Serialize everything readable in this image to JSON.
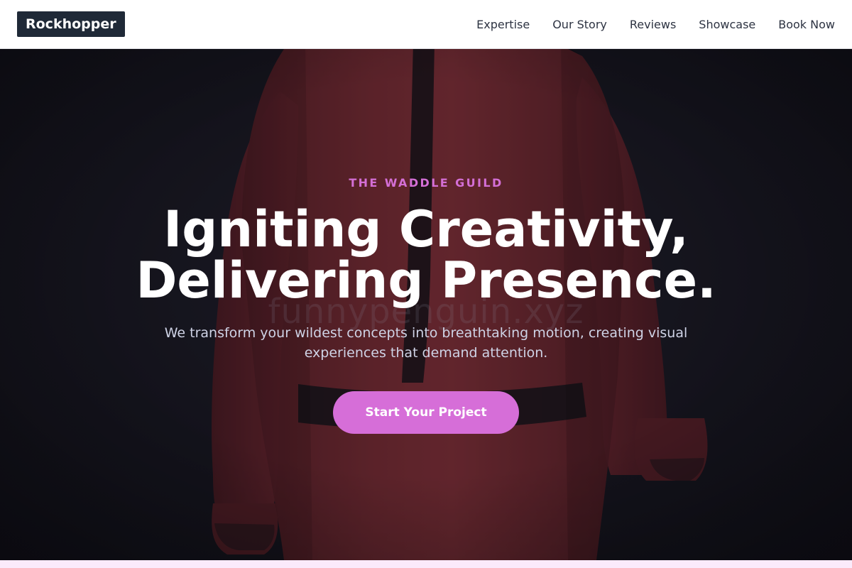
{
  "header": {
    "brand": "Rockhopper",
    "nav": [
      {
        "label": "Expertise"
      },
      {
        "label": "Our Story"
      },
      {
        "label": "Reviews"
      },
      {
        "label": "Showcase"
      },
      {
        "label": "Book Now"
      }
    ]
  },
  "hero": {
    "eyebrow": "THE WADDLE GUILD",
    "headline_line1": "Igniting Creativity,",
    "headline_line2": "Delivering Presence.",
    "subtext": "We transform your wildest concepts into breathtaking motion, creating visual experiences that demand attention.",
    "cta_label": "Start Your Project",
    "watermark": "funnypenguin.xyz",
    "image_subject": "red-suited-figure-back-view"
  },
  "colors": {
    "accent": "#d66ed8",
    "eyebrow": "#d46fd6",
    "brand_bg": "#1f2937",
    "hero_bg": "#17161f"
  }
}
